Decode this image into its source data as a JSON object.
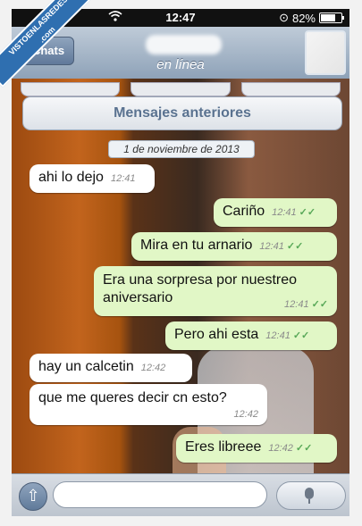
{
  "status_bar": {
    "time": "12:47",
    "battery": "82%",
    "battery_level": 0.82
  },
  "nav": {
    "back_label": "Chats",
    "contact_status": "en línea"
  },
  "older_messages_label": "Mensajes anteriores",
  "date_separator": "1 de noviembre de 2013",
  "messages": [
    {
      "direction": "in",
      "text": "ahi lo dejo",
      "time": "12:41"
    },
    {
      "direction": "out",
      "text": "Cariño",
      "time": "12:41"
    },
    {
      "direction": "out",
      "text": "Mira en tu arnario",
      "time": "12:41"
    },
    {
      "direction": "out",
      "text": "Era una sorpresa por nuestreo aniversario",
      "time": "12:41"
    },
    {
      "direction": "out",
      "text": "Pero ahi esta",
      "time": "12:41"
    },
    {
      "direction": "in",
      "text": "hay un calcetin",
      "time": "12:42"
    },
    {
      "direction": "in",
      "text": "que me queres decir cn esto?",
      "time": "12:42"
    },
    {
      "direction": "out",
      "text": "Eres libreee",
      "time": "12:42"
    }
  ],
  "read_ticks": "✓✓",
  "composer": {
    "placeholder": ""
  },
  "watermark": {
    "line1": "VISTOENLASREDES",
    "line2": ".com"
  },
  "colors": {
    "outgoing_bubble": "#e1f7c6",
    "incoming_bubble": "#ffffff",
    "nav_bar": "#8ea2b8",
    "ticks": "#58a858"
  }
}
